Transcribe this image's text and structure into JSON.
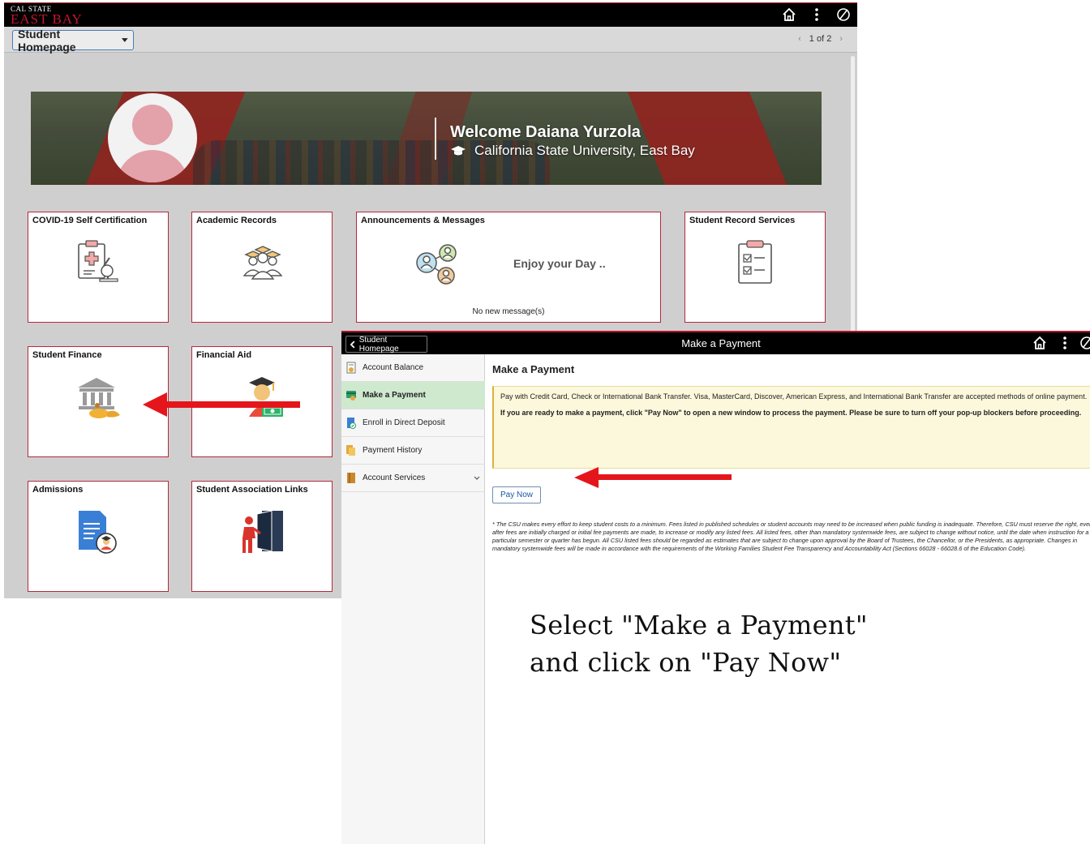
{
  "home": {
    "logo_line1": "CAL STATE",
    "logo_line2": "EAST BAY",
    "dropdown_label": "Student Homepage",
    "pager": {
      "text": "1 of 2"
    },
    "welcome": "Welcome Daiana Yurzola",
    "university": "California State University, East Bay",
    "tiles": {
      "covid": "COVID-19 Self Certification",
      "academic": "Academic Records",
      "announcements": "Announcements & Messages",
      "announcement_text": "Enjoy your Day ..",
      "no_messages": "No new message(s)",
      "record_services": "Student Record Services",
      "finance": "Student Finance",
      "financial_aid": "Financial Aid",
      "admissions": "Admissions",
      "association": "Student Association Links"
    }
  },
  "payment": {
    "back_label": "Student Homepage",
    "title": "Make a Payment",
    "nav": [
      {
        "label": "Account Balance",
        "icon": "document-coin-icon"
      },
      {
        "label": "Make a Payment",
        "icon": "payment-card-icon"
      },
      {
        "label": "Enroll in Direct Deposit",
        "icon": "direct-deposit-icon"
      },
      {
        "label": "Payment History",
        "icon": "history-icon"
      },
      {
        "label": "Account Services",
        "icon": "services-icon"
      }
    ],
    "heading": "Make a Payment",
    "info_1": "Pay with Credit Card, Check or International Bank Transfer. Visa, MasterCard, Discover, American Express, and International Bank Transfer are accepted methods of online payment.",
    "info_2": "If you are ready to make a payment, click \"Pay Now\" to open a new window to process the payment. Please be sure to turn off your pop-up blockers before proceeding.",
    "pay_now": "Pay Now",
    "disclaimer": "* The CSU makes every effort to keep student costs to a minimum. Fees listed in published schedules or student accounts may need to be increased when public funding is inadequate. Therefore, CSU must reserve the right, even after fees are initially charged or initial fee payments are made, to increase or modify any listed fees. All listed fees, other than mandatory systemwide fees, are subject to change without notice, until the date when instruction for a particular semester or quarter has begun. All CSU listed fees should be regarded as estimates that are subject to change upon approval by the Board of Trustees, the Chancellor, or the Presidents, as appropriate. Changes in mandatory systemwide fees will be made in accordance with the requirements of the Working Families Student Fee Transparency and Accountability Act (Sections 66028 - 66028.6 of the Education Code)."
  },
  "instruction": {
    "line1": "Select \"Make a Payment\"",
    "line2": "and click on \"Pay Now\""
  },
  "colors": {
    "brand_red": "#b0132a",
    "arrow_red": "#e4161b",
    "active_nav": "#cfe9cf",
    "info_bg": "#fcf8dc",
    "link_blue": "#1a56a0"
  }
}
